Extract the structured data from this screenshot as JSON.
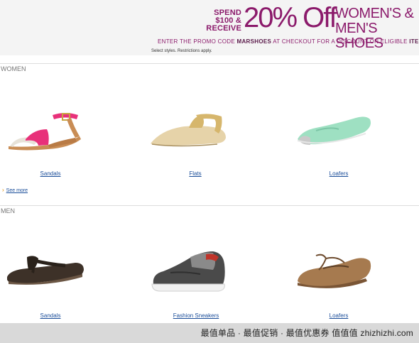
{
  "banner": {
    "spend_text": "SPEND $100 & RECEIVE",
    "discount": "20% Off",
    "category": "WOMEN'S & MEN'S SHOES",
    "promo_pre": "ENTER THE PROMO CODE ",
    "promo_code": "MARSHOES",
    "promo_mid": " AT CHECKOUT FOR A DISCOUNT ON ELIGIBLE ",
    "promo_end": "ITEMS SOLD A",
    "restrictions": "Select styles. Restrictions apply.",
    "accent_color": "#8b1a6b"
  },
  "women": {
    "label": "WOMEN",
    "items": [
      {
        "label": "Sandals",
        "icon": "pink-ankle-strap-sandal"
      },
      {
        "label": "Flats",
        "icon": "beige-gold-flat"
      },
      {
        "label": "Loafers",
        "icon": "mint-loafer"
      }
    ],
    "see_more": "See more"
  },
  "men": {
    "label": "MEN",
    "items": [
      {
        "label": "Sandals",
        "icon": "brown-flip-flop"
      },
      {
        "label": "Fashion Sneakers",
        "icon": "grey-sneaker"
      },
      {
        "label": "Loafers",
        "icon": "tan-boat-loafer"
      }
    ]
  },
  "footer": {
    "watermark": "最值单品 · 最值促销 · 最值优惠券  值值值 zhizhizhi.com"
  }
}
